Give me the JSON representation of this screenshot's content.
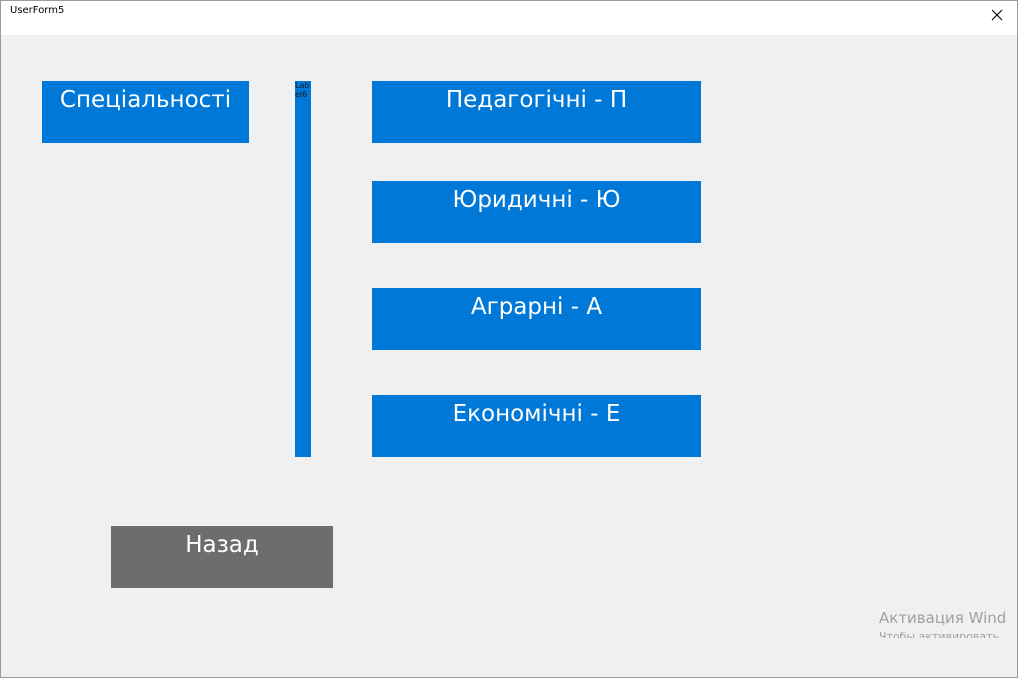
{
  "window": {
    "title": "UserForm5",
    "close_icon": "close-icon"
  },
  "header_label": "Спеціальності",
  "side_label": "Label6",
  "buttons": [
    {
      "label": "Педагогічні - П"
    },
    {
      "label": "Юридичні - Ю"
    },
    {
      "label": "Аграрні - А"
    },
    {
      "label": "Економічні - Е"
    }
  ],
  "back_button": "Назад",
  "watermark": {
    "line1": "Активация Wind",
    "line2": "Чтобы активировать"
  },
  "colors": {
    "accent": "#0078d7",
    "back": "#6d6d6d",
    "background": "#f0f0f0"
  }
}
